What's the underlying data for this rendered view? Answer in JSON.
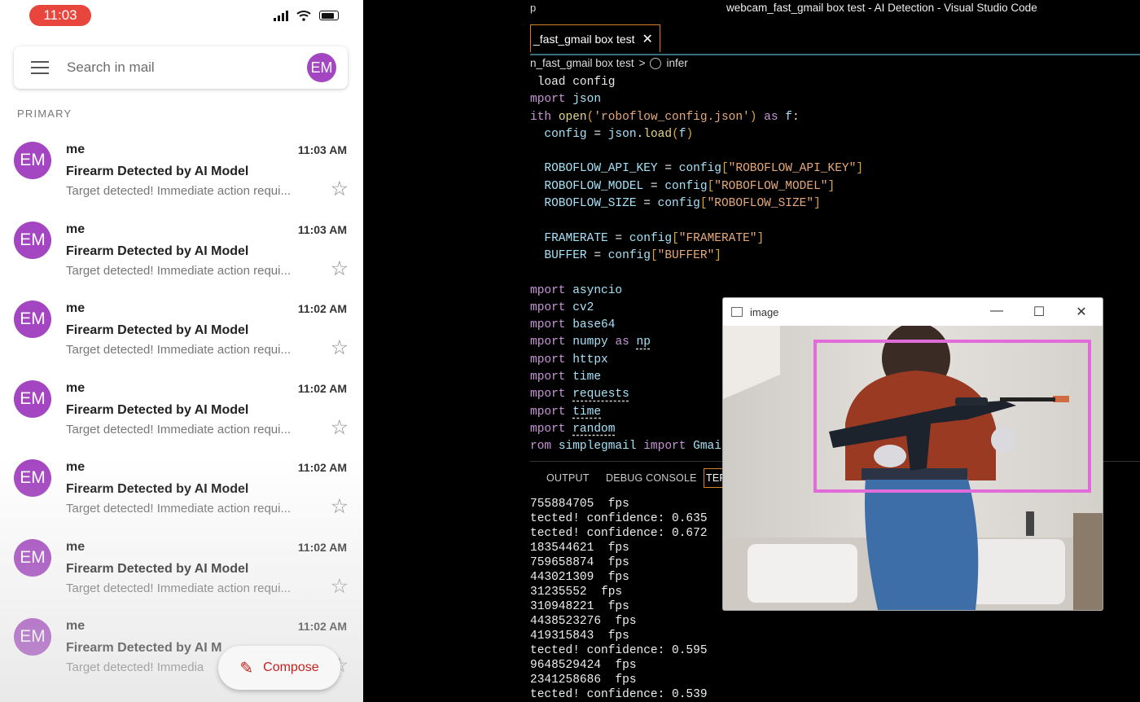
{
  "phone": {
    "status_time": "11:03",
    "search": {
      "placeholder": "Search in mail",
      "menu_icon": "menu-icon"
    },
    "avatar_initials": "EM",
    "section_label": "PRIMARY",
    "emails": [
      {
        "sender": "me",
        "time": "11:03 AM",
        "subject": "Firearm Detected by AI Model",
        "preview": "Target detected! Immediate action requi..."
      },
      {
        "sender": "me",
        "time": "11:03 AM",
        "subject": "Firearm Detected by AI Model",
        "preview": "Target detected! Immediate action requi..."
      },
      {
        "sender": "me",
        "time": "11:02 AM",
        "subject": "Firearm Detected by AI Model",
        "preview": "Target detected! Immediate action requi..."
      },
      {
        "sender": "me",
        "time": "11:02 AM",
        "subject": "Firearm Detected by AI Model",
        "preview": "Target detected! Immediate action requi..."
      },
      {
        "sender": "me",
        "time": "11:02 AM",
        "subject": "Firearm Detected by AI Model",
        "preview": "Target detected! Immediate action requi..."
      },
      {
        "sender": "me",
        "time": "11:02 AM",
        "subject": "Firearm Detected by AI Model",
        "preview": "Target detected! Immediate action requi..."
      },
      {
        "sender": "me",
        "time": "11:02 AM",
        "subject": "Firearm Detected by AI M",
        "preview": "Target detected! Immedia"
      }
    ],
    "compose_label": "Compose",
    "colors": {
      "avatar": "#a445c1",
      "status_pill": "#e8453c",
      "compose_text": "#c5221f"
    }
  },
  "vscode": {
    "menu_fragment": "p",
    "window_title": "webcam_fast_gmail box test - AI Detection - Visual Studio Code",
    "tab_label": "_fast_gmail box test",
    "breadcrumb_file": "n_fast_gmail box test",
    "breadcrumb_separator": ">",
    "breadcrumb_symbol": "infer",
    "panel_tabs": [
      "OUTPUT",
      "DEBUG CONSOLE",
      "TER"
    ],
    "terminal_lines": [
      "755884705  fps",
      "tected! confidence: 0.635",
      "tected! confidence: 0.672",
      "183544621  fps",
      "759658874  fps",
      "443021309  fps",
      "31235552  fps",
      "310948221  fps",
      "4438523276  fps",
      "419315843  fps",
      "tected! confidence: 0.595",
      "9648529424  fps",
      "2341258686  fps",
      "tected! confidence: 0.539"
    ]
  },
  "image_window": {
    "title": "image",
    "controls": [
      "—",
      "☐",
      "✕"
    ]
  }
}
